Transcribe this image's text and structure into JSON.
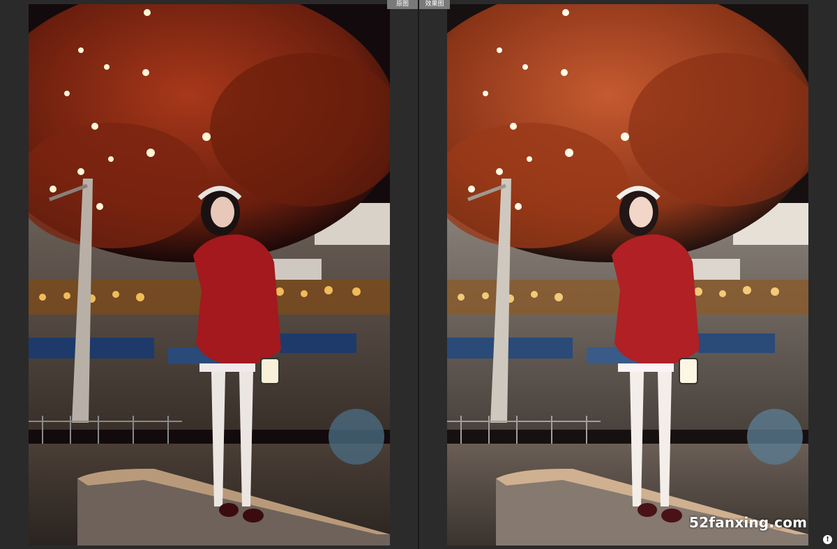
{
  "tabs": {
    "before_label": "原图",
    "after_label": "效果图"
  },
  "watermark": {
    "text": "52fanxing.com"
  },
  "info_icon": {
    "glyph": "!"
  },
  "colors": {
    "tab_bg": "#7a7a7a",
    "background": "#2a2a2a",
    "coat": "#a3191d",
    "leaves": "#8a2a12"
  },
  "icons": [
    "info-icon"
  ]
}
